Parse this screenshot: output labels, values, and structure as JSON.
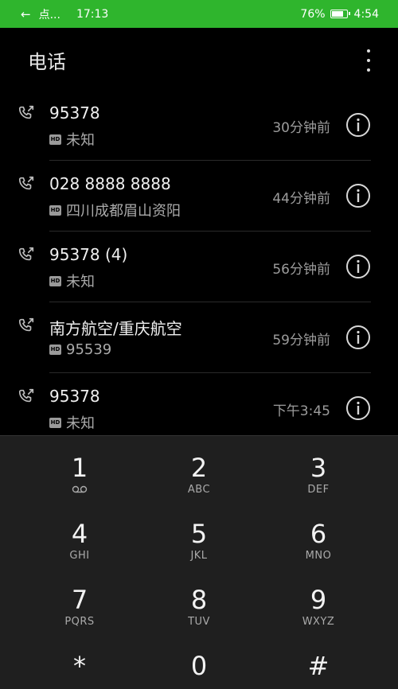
{
  "status_bar": {
    "app_label": "点...",
    "time_left": "17:13",
    "battery_percent": "76%",
    "time_right": "4:54"
  },
  "header": {
    "title": "电话"
  },
  "calls": [
    {
      "name": "95378",
      "sub": "未知",
      "time": "30分钟前"
    },
    {
      "name": "028 8888 8888",
      "sub": "四川成都眉山资阳",
      "time": "44分钟前"
    },
    {
      "name": "95378 (4)",
      "sub": "未知",
      "time": "56分钟前"
    },
    {
      "name": "南方航空/重庆航空",
      "sub": "95539",
      "time": "59分钟前"
    },
    {
      "name": "95378",
      "sub": "未知",
      "time": "下午3:45"
    }
  ],
  "hd_badge": "HD",
  "dialpad": {
    "keys": [
      {
        "digit": "1",
        "letters": ""
      },
      {
        "digit": "2",
        "letters": "ABC"
      },
      {
        "digit": "3",
        "letters": "DEF"
      },
      {
        "digit": "4",
        "letters": "GHI"
      },
      {
        "digit": "5",
        "letters": "JKL"
      },
      {
        "digit": "6",
        "letters": "MNO"
      },
      {
        "digit": "7",
        "letters": "PQRS"
      },
      {
        "digit": "8",
        "letters": "TUV"
      },
      {
        "digit": "9",
        "letters": "WXYZ"
      },
      {
        "digit": "*",
        "letters": ""
      },
      {
        "digit": "0",
        "letters": ""
      },
      {
        "digit": "#",
        "letters": ""
      }
    ]
  },
  "colors": {
    "status_bar": "#2fb52d",
    "background": "#000000",
    "dialpad": "#1f1f1f"
  }
}
